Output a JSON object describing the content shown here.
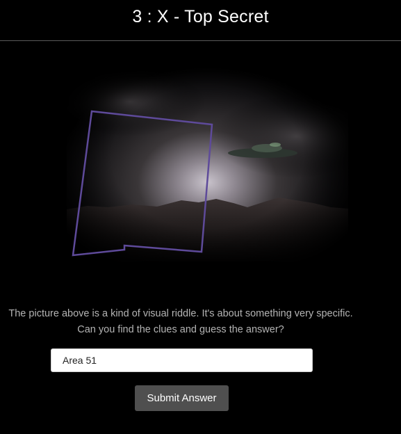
{
  "header": {
    "title": "3 : X - Top Secret"
  },
  "riddle": {
    "line1": "The picture above is a kind of visual riddle. It's about something very specific.",
    "line2": "Can you find the clues and guess the answer?"
  },
  "answer": {
    "value": "Area 51",
    "placeholder": ""
  },
  "submit": {
    "label": "Submit Answer"
  },
  "colors": {
    "background": "#000000",
    "outline": "#5e4a9a",
    "button": "#4f4f4f"
  }
}
